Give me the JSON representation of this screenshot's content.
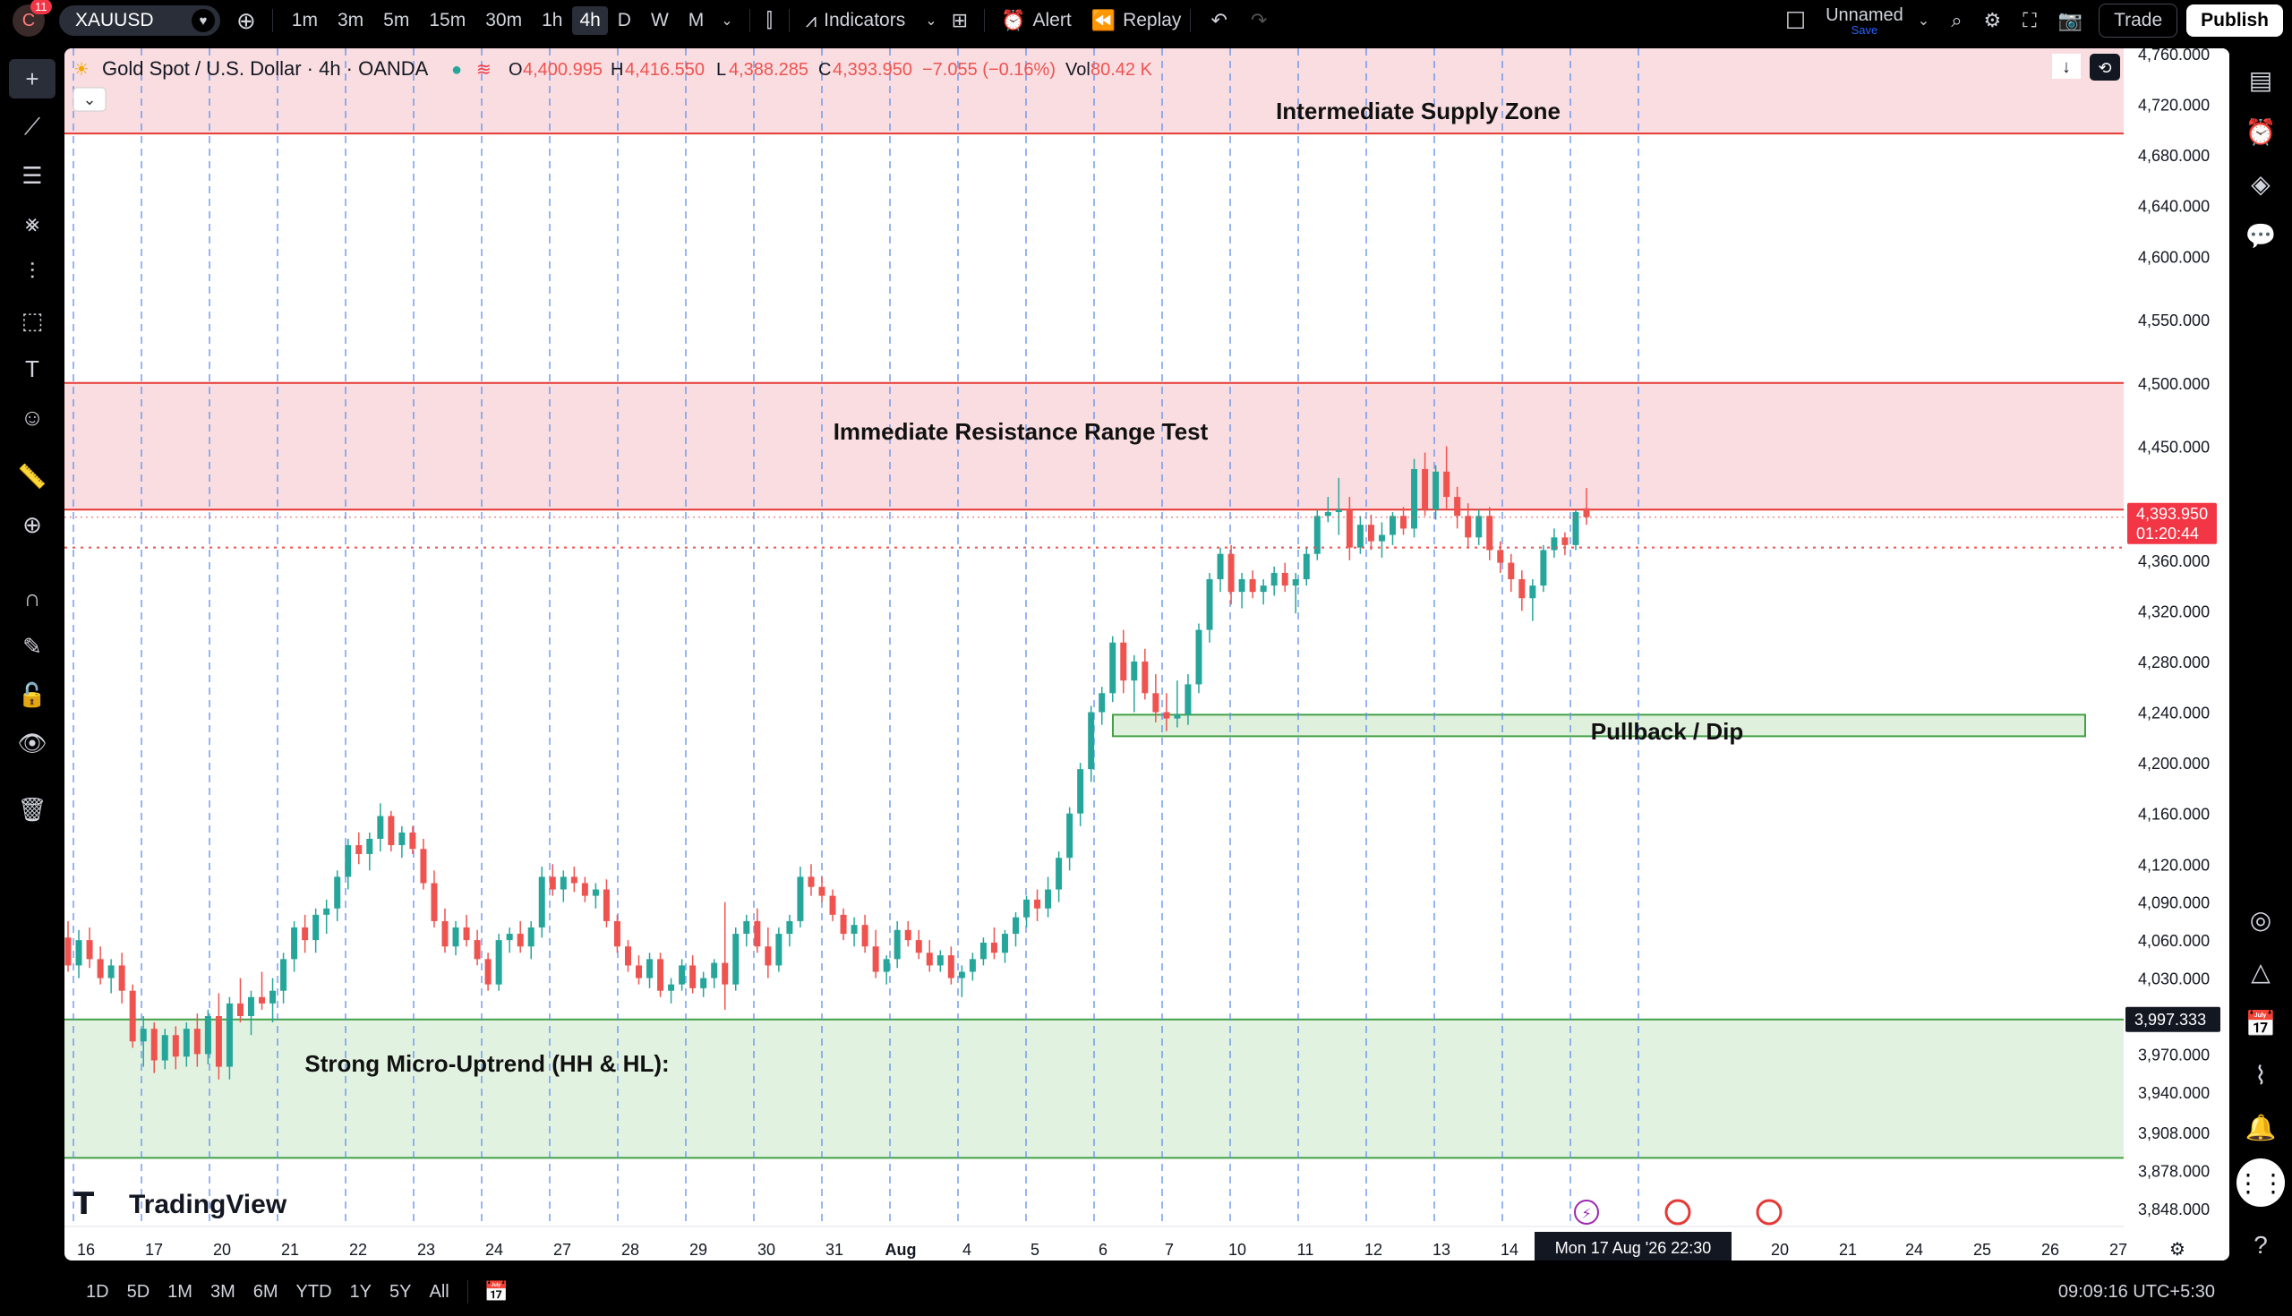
{
  "toolbar": {
    "notif_count": "11",
    "symbol": "XAUUSD",
    "timeframes": [
      "1m",
      "3m",
      "5m",
      "15m",
      "30m",
      "1h",
      "4h",
      "D",
      "W",
      "M"
    ],
    "active_timeframe": "4h",
    "indicators_label": "Indicators",
    "alert_label": "Alert",
    "replay_label": "Replay",
    "layout_name": "Unnamed",
    "layout_save": "Save",
    "trade_label": "Trade",
    "publish_label": "Publish"
  },
  "legend": {
    "title": "Gold Spot / U.S. Dollar · 4h · OANDA",
    "o_label": "O",
    "o": "4,400.995",
    "h_label": "H",
    "h": "4,416.550",
    "l_label": "L",
    "l": "4,388.285",
    "c_label": "C",
    "c": "4,393.950",
    "change": "−7.055 (−0.16%)",
    "vol_label": "Vol",
    "vol": "80.42 K"
  },
  "annotations": {
    "supply": "Intermediate Supply Zone",
    "resistance": "Immediate Resistance Range Test",
    "pullback": "Pullback / Dip",
    "uptrend": "Strong Micro-Uptrend (HH & HL):"
  },
  "logo_text": "TradingView",
  "price_axis": [
    "4,760.000",
    "4,720.000",
    "4,680.000",
    "4,640.000",
    "4,600.000",
    "4,550.000",
    "4,500.000",
    "4,450.000",
    "4,400.000",
    "4,360.000",
    "4,320.000",
    "4,280.000",
    "4,240.000",
    "4,200.000",
    "4,160.000",
    "4,120.000",
    "4,090.000",
    "4,060.000",
    "4,030.000",
    "3,970.000",
    "3,940.000",
    "3,908.000",
    "3,878.000",
    "3,848.000"
  ],
  "price_tag": {
    "price": "4,393.950",
    "countdown": "01:20:44"
  },
  "line_tag": "3,997.333",
  "time_axis": [
    "16",
    "17",
    "20",
    "21",
    "22",
    "23",
    "24",
    "27",
    "28",
    "29",
    "30",
    "31",
    "Aug",
    "4",
    "5",
    "6",
    "7",
    "10",
    "11",
    "12",
    "13",
    "14",
    "20",
    "21",
    "24",
    "25",
    "26",
    "27"
  ],
  "crosshair_date": "Mon 17 Aug '26   22:30",
  "bottom": {
    "ranges": [
      "1D",
      "5D",
      "1M",
      "3M",
      "6M",
      "YTD",
      "1Y",
      "5Y",
      "All"
    ],
    "clock": "09:09:16 UTC+5:30"
  },
  "colors": {
    "up": "#26a69a",
    "down": "#ef5350",
    "supply_fill": "#f9dde0",
    "demand_fill": "#e2f2e1"
  },
  "chart_data": {
    "type": "candlestick",
    "ohlc": [
      [
        4062,
        4075,
        4035,
        4040
      ],
      [
        4040,
        4068,
        4030,
        4060
      ],
      [
        4060,
        4070,
        4038,
        4045
      ],
      [
        4045,
        4055,
        4025,
        4030
      ],
      [
        4030,
        4045,
        4018,
        4040
      ],
      [
        4040,
        4050,
        4010,
        4020
      ],
      [
        4020,
        4025,
        3975,
        3980
      ],
      [
        3980,
        4000,
        3960,
        3990
      ],
      [
        3990,
        3995,
        3955,
        3965
      ],
      [
        3965,
        3990,
        3958,
        3985
      ],
      [
        3985,
        3992,
        3958,
        3968
      ],
      [
        3968,
        3995,
        3960,
        3990
      ],
      [
        3990,
        4002,
        3960,
        3970
      ],
      [
        3970,
        4005,
        3962,
        4000
      ],
      [
        4000,
        4018,
        3950,
        3960
      ],
      [
        3960,
        4015,
        3950,
        4010
      ],
      [
        4010,
        4030,
        3995,
        4000
      ],
      [
        4000,
        4020,
        3985,
        4015
      ],
      [
        4015,
        4035,
        4005,
        4010
      ],
      [
        4010,
        4030,
        3995,
        4020
      ],
      [
        4020,
        4050,
        4010,
        4045
      ],
      [
        4045,
        4075,
        4035,
        4070
      ],
      [
        4070,
        4080,
        4050,
        4060
      ],
      [
        4060,
        4085,
        4050,
        4080
      ],
      [
        4080,
        4092,
        4065,
        4085
      ],
      [
        4085,
        4115,
        4075,
        4110
      ],
      [
        4110,
        4140,
        4100,
        4135
      ],
      [
        4135,
        4145,
        4120,
        4128
      ],
      [
        4128,
        4145,
        4115,
        4140
      ],
      [
        4140,
        4168,
        4130,
        4158
      ],
      [
        4158,
        4162,
        4130,
        4135
      ],
      [
        4135,
        4150,
        4125,
        4145
      ],
      [
        4145,
        4150,
        4128,
        4132
      ],
      [
        4132,
        4140,
        4100,
        4105
      ],
      [
        4105,
        4115,
        4070,
        4075
      ],
      [
        4075,
        4085,
        4050,
        4055
      ],
      [
        4055,
        4075,
        4048,
        4070
      ],
      [
        4070,
        4080,
        4055,
        4060
      ],
      [
        4060,
        4068,
        4040,
        4045
      ],
      [
        4045,
        4050,
        4020,
        4025
      ],
      [
        4025,
        4065,
        4020,
        4060
      ],
      [
        4060,
        4070,
        4050,
        4065
      ],
      [
        4065,
        4075,
        4050,
        4055
      ],
      [
        4055,
        4075,
        4045,
        4070
      ],
      [
        4070,
        4118,
        4062,
        4110
      ],
      [
        4110,
        4120,
        4095,
        4100
      ],
      [
        4100,
        4115,
        4090,
        4110
      ],
      [
        4110,
        4118,
        4098,
        4105
      ],
      [
        4105,
        4110,
        4090,
        4095
      ],
      [
        4095,
        4105,
        4085,
        4100
      ],
      [
        4100,
        4108,
        4070,
        4075
      ],
      [
        4075,
        4080,
        4050,
        4055
      ],
      [
        4055,
        4060,
        4035,
        4040
      ],
      [
        4040,
        4048,
        4025,
        4030
      ],
      [
        4030,
        4050,
        4022,
        4045
      ],
      [
        4045,
        4050,
        4015,
        4020
      ],
      [
        4020,
        4030,
        4010,
        4025
      ],
      [
        4025,
        4045,
        4020,
        4040
      ],
      [
        4040,
        4048,
        4018,
        4022
      ],
      [
        4022,
        4035,
        4015,
        4030
      ],
      [
        4030,
        4045,
        4022,
        4042
      ],
      [
        4042,
        4090,
        4005,
        4025
      ],
      [
        4025,
        4070,
        4020,
        4065
      ],
      [
        4065,
        4080,
        4055,
        4075
      ],
      [
        4075,
        4085,
        4050,
        4055
      ],
      [
        4055,
        4070,
        4030,
        4040
      ],
      [
        4040,
        4070,
        4035,
        4065
      ],
      [
        4065,
        4080,
        4055,
        4075
      ],
      [
        4075,
        4118,
        4070,
        4110
      ],
      [
        4110,
        4120,
        4095,
        4102
      ],
      [
        4102,
        4110,
        4090,
        4095
      ],
      [
        4095,
        4100,
        4075,
        4080
      ],
      [
        4080,
        4085,
        4060,
        4065
      ],
      [
        4065,
        4078,
        4055,
        4072
      ],
      [
        4072,
        4080,
        4050,
        4055
      ],
      [
        4055,
        4068,
        4030,
        4035
      ],
      [
        4035,
        4048,
        4025,
        4045
      ],
      [
        4045,
        4075,
        4038,
        4068
      ],
      [
        4068,
        4075,
        4055,
        4060
      ],
      [
        4060,
        4068,
        4045,
        4050
      ],
      [
        4050,
        4060,
        4035,
        4040
      ],
      [
        4040,
        4052,
        4035,
        4048
      ],
      [
        4048,
        4055,
        4025,
        4030
      ],
      [
        4030,
        4040,
        4015,
        4035
      ],
      [
        4035,
        4050,
        4028,
        4045
      ],
      [
        4045,
        4062,
        4040,
        4058
      ],
      [
        4058,
        4070,
        4045,
        4050
      ],
      [
        4050,
        4068,
        4042,
        4065
      ],
      [
        4065,
        4082,
        4055,
        4078
      ],
      [
        4078,
        4095,
        4070,
        4092
      ],
      [
        4092,
        4100,
        4075,
        4085
      ],
      [
        4085,
        4110,
        4078,
        4100
      ],
      [
        4100,
        4130,
        4090,
        4125
      ],
      [
        4125,
        4165,
        4115,
        4160
      ],
      [
        4160,
        4200,
        4150,
        4195
      ],
      [
        4195,
        4245,
        4185,
        4240
      ],
      [
        4240,
        4260,
        4230,
        4255
      ],
      [
        4255,
        4300,
        4248,
        4295
      ],
      [
        4295,
        4305,
        4255,
        4265
      ],
      [
        4265,
        4285,
        4240,
        4280
      ],
      [
        4280,
        4290,
        4250,
        4255
      ],
      [
        4255,
        4270,
        4232,
        4240
      ],
      [
        4240,
        4255,
        4225,
        4235
      ],
      [
        4235,
        4265,
        4228,
        4238
      ],
      [
        4238,
        4270,
        4230,
        4262
      ],
      [
        4262,
        4310,
        4255,
        4305
      ],
      [
        4305,
        4350,
        4295,
        4345
      ],
      [
        4345,
        4370,
        4335,
        4365
      ],
      [
        4365,
        4372,
        4325,
        4335
      ],
      [
        4335,
        4350,
        4322,
        4345
      ],
      [
        4345,
        4352,
        4330,
        4335
      ],
      [
        4335,
        4345,
        4325,
        4340
      ],
      [
        4340,
        4355,
        4332,
        4350
      ],
      [
        4350,
        4358,
        4335,
        4340
      ],
      [
        4340,
        4350,
        4318,
        4345
      ],
      [
        4345,
        4370,
        4340,
        4365
      ],
      [
        4365,
        4400,
        4360,
        4395
      ],
      [
        4395,
        4410,
        4390,
        4398
      ],
      [
        4398,
        4425,
        4380,
        4400
      ],
      [
        4400,
        4410,
        4360,
        4370
      ],
      [
        4370,
        4395,
        4365,
        4388
      ],
      [
        4388,
        4396,
        4368,
        4375
      ],
      [
        4375,
        4390,
        4362,
        4380
      ],
      [
        4380,
        4398,
        4372,
        4395
      ],
      [
        4395,
        4402,
        4380,
        4385
      ],
      [
        4385,
        4440,
        4378,
        4432
      ],
      [
        4432,
        4445,
        4395,
        4400
      ],
      [
        4400,
        4435,
        4392,
        4430
      ],
      [
        4430,
        4450,
        4400,
        4410
      ],
      [
        4410,
        4418,
        4385,
        4395
      ],
      [
        4395,
        4405,
        4370,
        4378
      ],
      [
        4378,
        4400,
        4372,
        4395
      ],
      [
        4395,
        4402,
        4360,
        4368
      ],
      [
        4368,
        4375,
        4350,
        4358
      ],
      [
        4358,
        4365,
        4335,
        4345
      ],
      [
        4345,
        4352,
        4320,
        4330
      ],
      [
        4330,
        4345,
        4312,
        4340
      ],
      [
        4340,
        4372,
        4335,
        4368
      ],
      [
        4368,
        4385,
        4362,
        4378
      ],
      [
        4378,
        4382,
        4364,
        4372
      ],
      [
        4372,
        4400,
        4368,
        4398
      ],
      [
        4401,
        4417,
        4388,
        4394
      ]
    ],
    "y_range": [
      3830,
      4790
    ],
    "zones": [
      {
        "label": "Intermediate Supply Zone",
        "top": 4768,
        "bottom": 4697
      },
      {
        "label": "Immediate Resistance Range Test",
        "top": 4500,
        "bottom": 4400
      },
      {
        "label": "Pullback / Dip",
        "top": 4238,
        "bottom": 4221
      },
      {
        "label": "Strong Micro-Uptrend (HH & HL):",
        "top": 3997.333,
        "bottom": 3888
      }
    ],
    "current_price": 4393.95,
    "dotted_level": 4370
  }
}
